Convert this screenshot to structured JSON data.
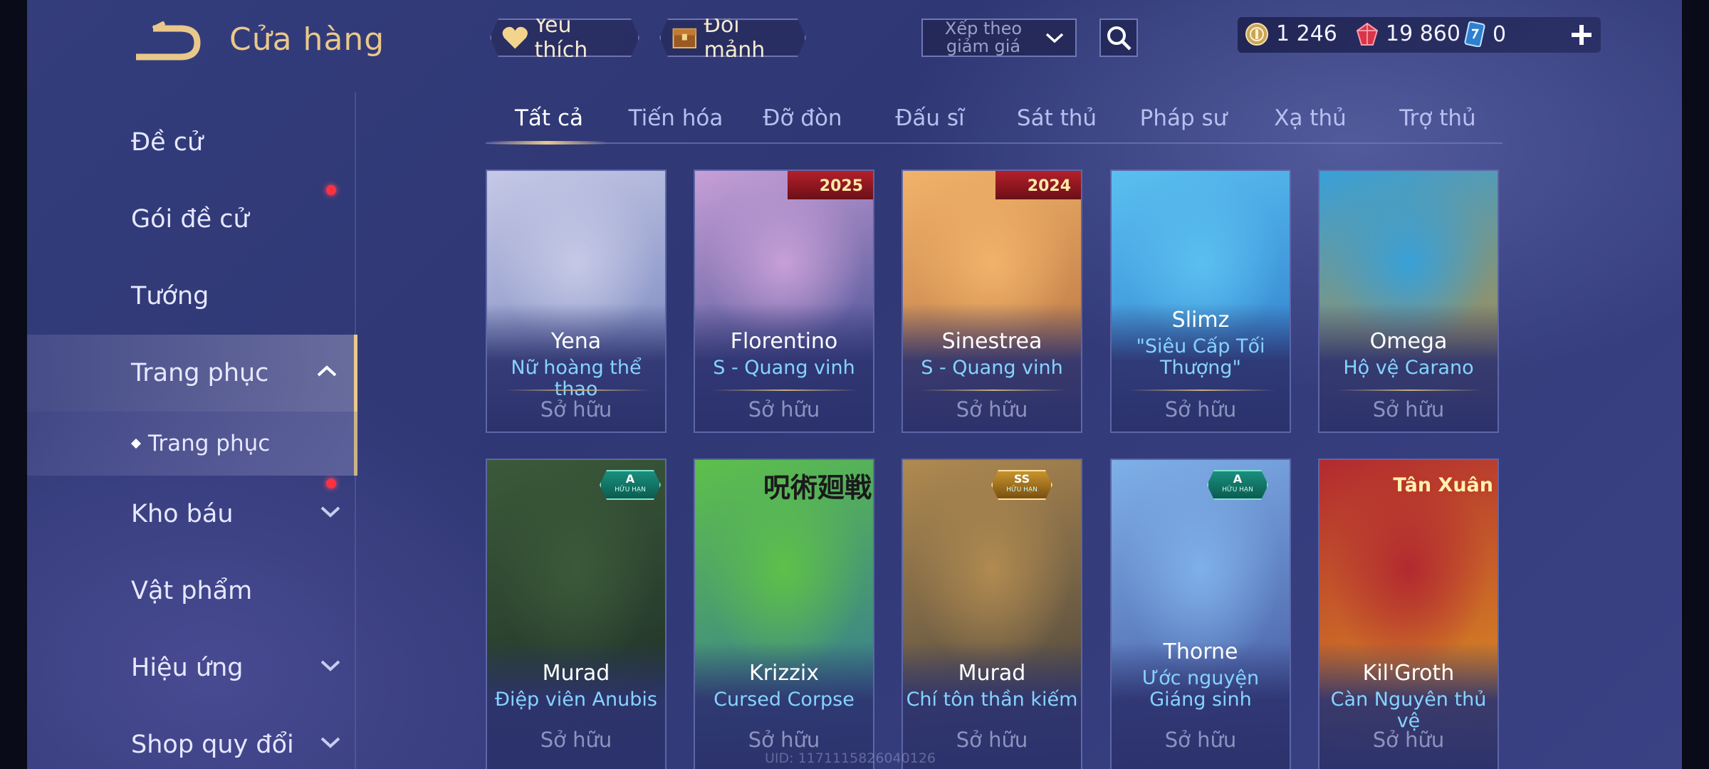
{
  "header": {
    "title": "Cửa hàng",
    "favorite_label": "Yêu thích",
    "shard_label": "Đổi mảnh",
    "sort_label": "Xếp theo giảm giá",
    "currencies": [
      {
        "icon": "gold-coin-icon",
        "value": "1 246"
      },
      {
        "icon": "ruby-gem-icon",
        "value": "19 860"
      },
      {
        "icon": "voucher-icon",
        "value": "0"
      }
    ]
  },
  "sidebar": {
    "items": [
      {
        "label": "Đề cử"
      },
      {
        "label": "Gói đề cử"
      },
      {
        "label": "Tướng"
      },
      {
        "label": "Trang phục"
      },
      {
        "label": "Trang phục"
      },
      {
        "label": "Kho báu"
      },
      {
        "label": "Vật phẩm"
      },
      {
        "label": "Hiệu ứng"
      },
      {
        "label": "Shop quy đổi"
      }
    ]
  },
  "tabs": [
    {
      "label": "Tất cả"
    },
    {
      "label": "Tiến hóa"
    },
    {
      "label": "Đỡ đòn"
    },
    {
      "label": "Đấu sĩ"
    },
    {
      "label": "Sát thủ"
    },
    {
      "label": "Pháp sư"
    },
    {
      "label": "Xạ thủ"
    },
    {
      "label": "Trợ thủ"
    }
  ],
  "cards": [
    {
      "hero": "Yena",
      "skin": "Nữ hoàng thể thao",
      "status": "Sở hữu",
      "colors": [
        "#c6c9e6",
        "#6b7bb8"
      ]
    },
    {
      "hero": "Florentino",
      "skin": "S - Quang vinh",
      "status": "Sở hữu",
      "badge": "2025",
      "colors": [
        "#c79fd6",
        "#2c3f86"
      ]
    },
    {
      "hero": "Sinestrea",
      "skin": "S - Quang vinh",
      "status": "Sở hữu",
      "badge": "2024",
      "colors": [
        "#f1b36a",
        "#b06a3c"
      ]
    },
    {
      "hero": "Slimz",
      "skin": "\"Siêu Cấp Tối Thượng\"",
      "status": "Sở hữu",
      "colors": [
        "#5ac0f0",
        "#2a74c8"
      ]
    },
    {
      "hero": "Omega",
      "skin": "Hộ vệ Carano",
      "status": "Sở hữu",
      "colors": [
        "#38a0d8",
        "#c48a2a"
      ]
    },
    {
      "hero": "Murad",
      "skin": "Điệp viên Anubis",
      "status": "Sở hữu",
      "tier": "A",
      "tier_sub": "HỮU HẠN",
      "colors": [
        "#3b5a3a",
        "#1c2a26"
      ]
    },
    {
      "hero": "Krizzix",
      "skin": "Cursed Corpse",
      "status": "Sở hữu",
      "badge_text": "呪術廻戦",
      "colors": [
        "#5ec04a",
        "#2f6ea0"
      ]
    },
    {
      "hero": "Murad",
      "skin": "Chí tôn thần kiếm",
      "status": "Sở hữu",
      "tier": "SS",
      "tier_sub": "HỮU HẠN",
      "colors": [
        "#b08a50",
        "#3a3a3a"
      ]
    },
    {
      "hero": "Thorne",
      "skin": "Ước nguyện Giáng sinh",
      "status": "Sở hữu",
      "tier": "A",
      "tier_sub": "HỮU HẠN",
      "colors": [
        "#7fb0e8",
        "#3e4f99"
      ]
    },
    {
      "hero": "Kil'Groth",
      "skin": "Càn Nguyên thủ vệ",
      "status": "Sở hữu",
      "badge_text": "Tân Xuân",
      "colors": [
        "#b22a30",
        "#e0a020"
      ]
    }
  ],
  "footer": {
    "uid": "UID: 1171115826040126"
  }
}
